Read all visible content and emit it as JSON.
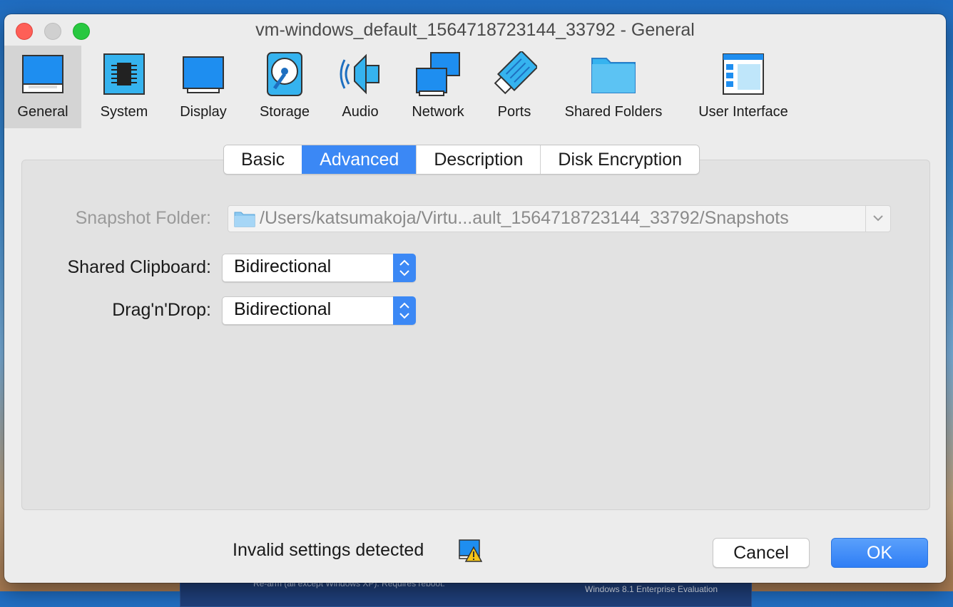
{
  "window": {
    "title": "vm-windows_default_1564718723144_33792 - General"
  },
  "background": {
    "text1": "Re-arm (all except Windows XP). Requires reboot.",
    "text2": "Windows 8.1 Enterprise Evaluation"
  },
  "toolbar": {
    "items": [
      {
        "label": "General",
        "icon": "general-icon",
        "active": true
      },
      {
        "label": "System",
        "icon": "system-icon"
      },
      {
        "label": "Display",
        "icon": "display-icon"
      },
      {
        "label": "Storage",
        "icon": "storage-icon"
      },
      {
        "label": "Audio",
        "icon": "audio-icon"
      },
      {
        "label": "Network",
        "icon": "network-icon"
      },
      {
        "label": "Ports",
        "icon": "ports-icon"
      },
      {
        "label": "Shared Folders",
        "icon": "shared-folders-icon"
      },
      {
        "label": "User Interface",
        "icon": "user-interface-icon"
      }
    ]
  },
  "tabs": [
    {
      "label": "Basic"
    },
    {
      "label": "Advanced",
      "selected": true
    },
    {
      "label": "Description"
    },
    {
      "label": "Disk Encryption"
    }
  ],
  "form": {
    "snapshot_label": "Snapshot Folder:",
    "snapshot_path": "/Users/katsumakoja/Virtu...ault_1564718723144_33792/Snapshots",
    "clipboard_label": "Shared Clipboard:",
    "clipboard_value": "Bidirectional",
    "dragdrop_label": "Drag'n'Drop:",
    "dragdrop_value": "Bidirectional"
  },
  "footer": {
    "status": "Invalid settings detected",
    "cancel_label": "Cancel",
    "ok_label": "OK"
  },
  "colors": {
    "accent": "#3b88f5",
    "close": "#fe5f57",
    "zoom": "#28c840"
  }
}
